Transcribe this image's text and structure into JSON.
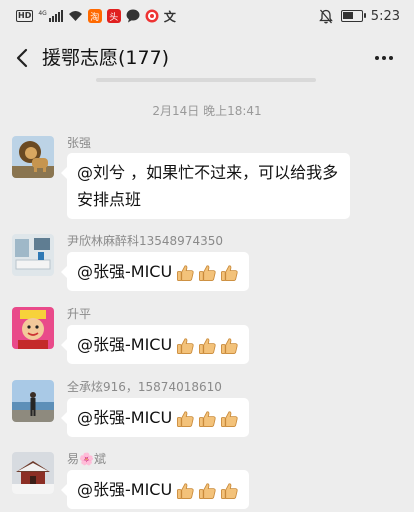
{
  "status_bar": {
    "time": "5:23",
    "network": "4G",
    "hd": "HD",
    "icons": [
      "hd-icon",
      "signal-icon",
      "wifi-icon",
      "app-taobao-icon",
      "app-toutiao-icon",
      "chat-bubble-icon",
      "app-target-icon",
      "app-wen-icon",
      "mute-bell-icon",
      "battery-icon"
    ],
    "app_glyphs": [
      "淘",
      "头",
      "文"
    ]
  },
  "header": {
    "title": "援鄂志愿(177)"
  },
  "time_divider": "2月14日 晚上18:41",
  "messages": [
    {
      "sender": "张强",
      "text": "@刘兮 ，如果忙不过来，可以给我多安排点班",
      "thumbs": 0,
      "avatar": "lion-avatar"
    },
    {
      "sender": "尹欣林麻醉科13548974350",
      "text": "@张强-MICU",
      "thumbs": 3,
      "avatar": "hospital-room-avatar"
    },
    {
      "sender": "升平",
      "text": "@张强-MICU",
      "thumbs": 3,
      "avatar": "cartoon-avatar"
    },
    {
      "sender": "全承炫916，15874018610",
      "text": "@张强-MICU",
      "thumbs": 3,
      "avatar": "beach-person-avatar"
    },
    {
      "sender": "易🌸斌",
      "text": "@张强-MICU",
      "thumbs": 3,
      "avatar": "snow-temple-avatar"
    }
  ],
  "colors": {
    "background": "#ededed",
    "bubble": "#ffffff",
    "sender": "#8a8a8a",
    "thumb": "#f3c27a"
  }
}
